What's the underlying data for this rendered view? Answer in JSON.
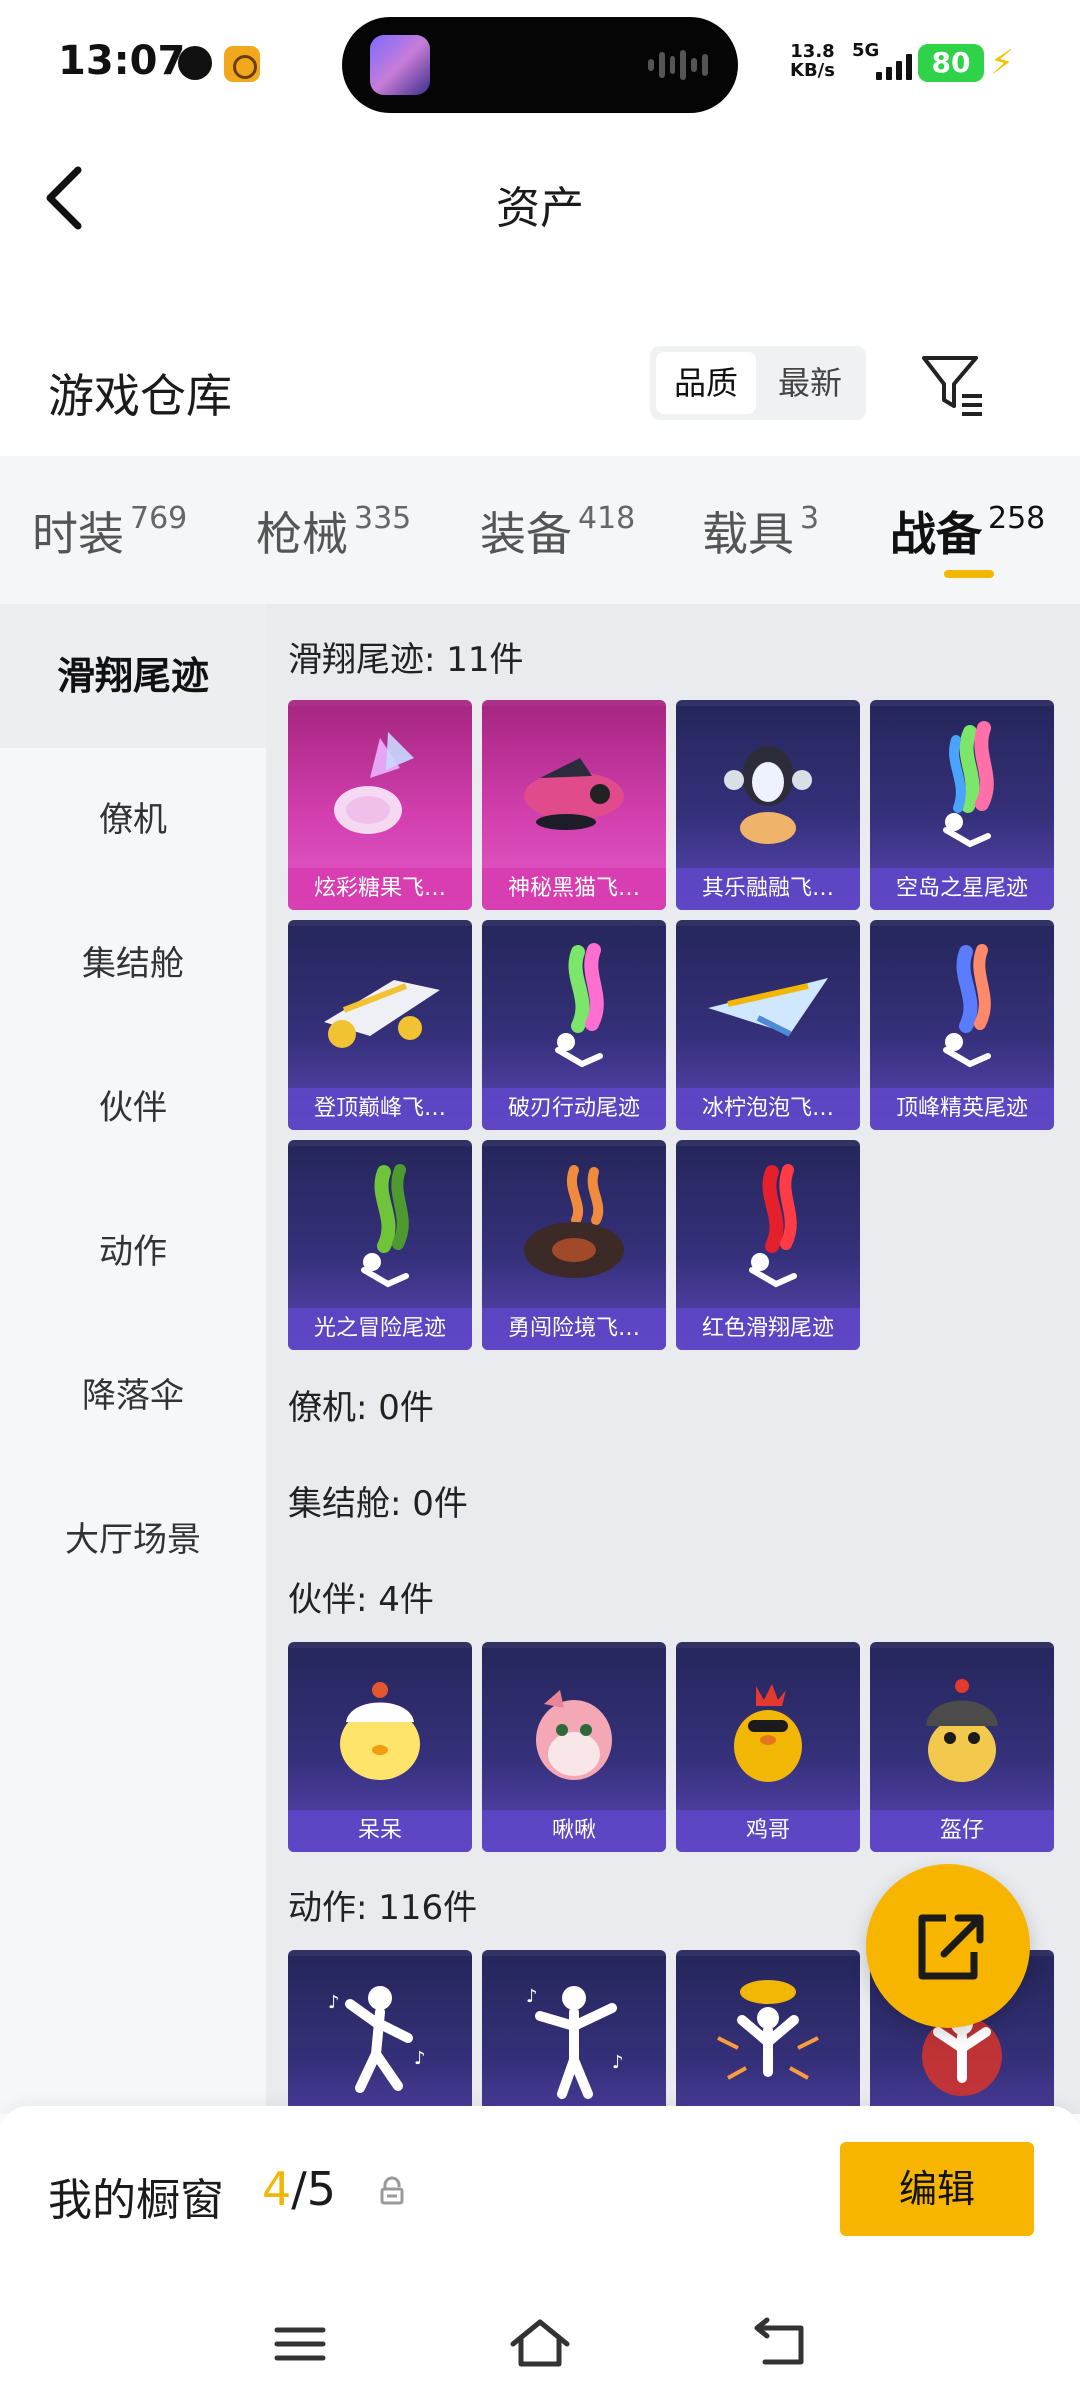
{
  "status_bar": {
    "time": "13:07",
    "net_speed_value": "13.8",
    "net_speed_unit": "KB/s",
    "signal": "5G",
    "battery": "80"
  },
  "header": {
    "title": "资产"
  },
  "warehouse": {
    "title": "游戏仓库",
    "sort_options": [
      "品质",
      "最新"
    ],
    "selected_sort": "品质"
  },
  "tabs": [
    {
      "label": "时装",
      "count": "769"
    },
    {
      "label": "枪械",
      "count": "335"
    },
    {
      "label": "装备",
      "count": "418"
    },
    {
      "label": "载具",
      "count": "3"
    },
    {
      "label": "战备",
      "count": "258"
    }
  ],
  "active_tab": "战备",
  "side_nav": [
    "滑翔尾迹",
    "僚机",
    "集结舱",
    "伙伴",
    "动作",
    "降落伞",
    "大厅场景"
  ],
  "active_side": "滑翔尾迹",
  "groups": {
    "glide": {
      "title": "滑翔尾迹: 11件",
      "items": [
        "炫彩糖果飞…",
        "神秘黑猫飞…",
        "其乐融融飞…",
        "空岛之星尾迹",
        "登顶巅峰飞…",
        "破刃行动尾迹",
        "冰柠泡泡飞…",
        "顶峰精英尾迹",
        "光之冒险尾迹",
        "勇闯险境飞…",
        "红色滑翔尾迹"
      ]
    },
    "wingman": {
      "title": "僚机: 0件"
    },
    "capsule": {
      "title": "集结舱: 0件"
    },
    "partner": {
      "title": "伙伴: 4件",
      "items": [
        "呆呆",
        "啾啾",
        "鸡哥",
        "盔仔"
      ]
    },
    "emote": {
      "title": "动作: 116件"
    }
  },
  "showcase": {
    "label": "我的橱窗",
    "current": "4",
    "separator": "/5",
    "edit_label": "编辑"
  },
  "colors": {
    "accent": "#f7b500",
    "card_epic": "#35307a",
    "card_legendary": "#d23fae"
  }
}
